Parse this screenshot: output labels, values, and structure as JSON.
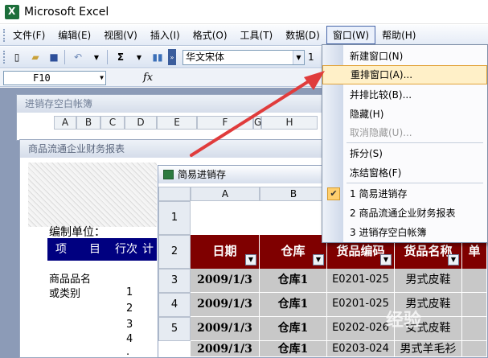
{
  "app": {
    "title": "Microsoft Excel"
  },
  "menubar": {
    "items": [
      "文件(F)",
      "编辑(E)",
      "视图(V)",
      "插入(I)",
      "格式(O)",
      "工具(T)",
      "数据(D)",
      "窗口(W)",
      "帮助(H)"
    ],
    "active_index": 7
  },
  "toolbar": {
    "font_name": "华文宋体",
    "font_size": "1"
  },
  "formula": {
    "cell_ref": "F10",
    "fx": "fx"
  },
  "win1": {
    "title": "进销存空白帐簿",
    "columns": [
      "A",
      "B",
      "C",
      "D",
      "E",
      "F",
      "G",
      "H"
    ]
  },
  "win2": {
    "title": "商品流通企业财务报表",
    "label": "编制单位：",
    "header": [
      "项　　目",
      "行次",
      "计"
    ],
    "rows": [
      "商品品名",
      "或类别"
    ],
    "row_numbers": [
      "1",
      "2",
      "3",
      "4",
      "·"
    ]
  },
  "win3": {
    "title": "简易进销存",
    "col_headers": [
      "A",
      "B",
      "C",
      "D",
      "E"
    ],
    "row_headers": [
      "1",
      "2",
      "3",
      "4",
      "5"
    ],
    "table_header": [
      "日期",
      "仓库",
      "货品编码",
      "货品名称",
      "单"
    ],
    "rows": [
      [
        "2009/1/3",
        "仓库1",
        "E0201-025",
        "男式皮鞋"
      ],
      [
        "2009/1/3",
        "仓库1",
        "E0201-025",
        "男式皮鞋"
      ],
      [
        "2009/1/3",
        "仓库1",
        "E0202-026",
        "女式皮鞋"
      ],
      [
        "2009/1/3",
        "仓库1",
        "E0203-024",
        "男式羊毛衫"
      ]
    ]
  },
  "window_menu": {
    "items": [
      {
        "label": "新建窗口(N)",
        "disabled": false
      },
      {
        "label": "重排窗口(A)...",
        "disabled": false,
        "highlighted": true
      },
      {
        "label": "并排比较(B)...",
        "disabled": false
      },
      {
        "label": "隐藏(H)",
        "disabled": false
      },
      {
        "label": "取消隐藏(U)...",
        "disabled": true
      },
      {
        "label": "拆分(S)",
        "disabled": false
      },
      {
        "label": "冻结窗格(F)",
        "disabled": false
      },
      {
        "label": "1 简易进销存",
        "disabled": false,
        "checked": true
      },
      {
        "label": "2 商品流通企业财务报表",
        "disabled": false
      },
      {
        "label": "3 进销存空白帐簿",
        "disabled": false
      }
    ]
  },
  "watermark": "经验",
  "colors": {
    "header_red": "#7f0000",
    "header_navy": "#000080",
    "menu_hover": "#fff0c8",
    "arrow": "#e03c3c"
  }
}
